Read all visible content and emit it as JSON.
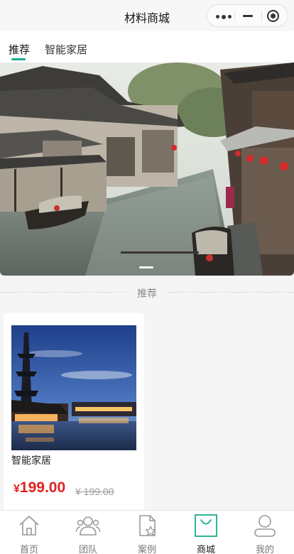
{
  "titlebar": {
    "title": "材料商城",
    "more_icon": "more-dots-icon",
    "minimize_icon": "minimize-icon",
    "close_icon": "target-circle-icon"
  },
  "tabs": [
    {
      "label": "推荐",
      "active": true
    },
    {
      "label": "智能家居",
      "active": false
    }
  ],
  "banner": {
    "image": "water-town-canal-photo",
    "dots": 1
  },
  "section": {
    "label": "推荐"
  },
  "products": [
    {
      "name": "智能家居",
      "currency": "¥",
      "price": "199.00",
      "original_price": "¥ 199.00",
      "image": "water-town-night-pagoda-photo"
    }
  ],
  "bottom_nav": [
    {
      "label": "首页",
      "icon": "home-icon",
      "active": false
    },
    {
      "label": "团队",
      "icon": "team-icon",
      "active": false
    },
    {
      "label": "案例",
      "icon": "case-document-icon",
      "active": false
    },
    {
      "label": "商城",
      "icon": "shopping-bag-icon",
      "active": true
    },
    {
      "label": "我的",
      "icon": "user-icon",
      "active": false
    }
  ],
  "colors": {
    "accent": "#1aad8d",
    "price": "#e02020",
    "page_bg": "#f5f5f5"
  }
}
